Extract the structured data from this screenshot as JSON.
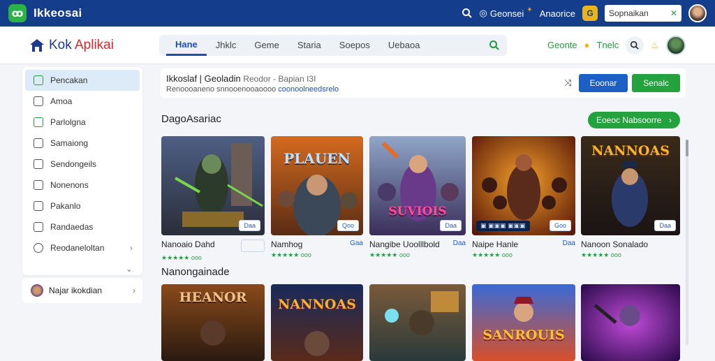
{
  "topbar": {
    "brand": "Ikkeosai",
    "link1": "Geonsei",
    "link2": "Anaorice",
    "gold_label": "G",
    "search_value": "Sopnaikan"
  },
  "navbar": {
    "title_a": "Kok ",
    "title_b": "Aplikai",
    "tabs": [
      "Hane",
      "Jhklc",
      "Geme",
      "Staria",
      "Soepos",
      "Uebaoa"
    ],
    "right_link": "Geonte",
    "right_text": "Tnelc"
  },
  "sidebar": {
    "items": [
      {
        "label": "Pencakan"
      },
      {
        "label": "Amoa"
      },
      {
        "label": "Parlolgna"
      },
      {
        "label": "Samaiong"
      },
      {
        "label": "Sendongeils"
      },
      {
        "label": "Nonenons"
      },
      {
        "label": "Pakanlo"
      },
      {
        "label": "Randaedas"
      },
      {
        "label": "Reodaneloltan"
      }
    ],
    "footer_label": "Najar ikokdian"
  },
  "toolbar": {
    "line1": "Ikkoslaf | Geoladin",
    "line1b": "Reodor - Bapian I3I",
    "line2": "Renoooaneno snnooenooaoooo",
    "line2b": "coonoolneedsrelo",
    "primary": "Eoonar",
    "secondary": "Senalc"
  },
  "section1": {
    "title": "DagoAsariac",
    "see_all": "Eoeoc Nabsoorre"
  },
  "section2": {
    "title": "Nanongainade"
  },
  "cards": [
    {
      "name": "Nanoaio Dahd",
      "tag": "",
      "badge": "Daa",
      "stars": "★★★★★ ooo",
      "cover": ""
    },
    {
      "name": "Namhog",
      "tag": "Gaa",
      "badge": "Qoo",
      "stars": "★★★★★ ooo",
      "cover": "PLAUEN"
    },
    {
      "name": "Nangibe Uoolllbold",
      "tag": "Daa",
      "badge": "Daa",
      "stars": "★★★★★ ooo",
      "cover": "SUVIOIS"
    },
    {
      "name": "Naipe Hanle",
      "tag": "Daa",
      "badge": "Goo",
      "stars": "★★★★★ ooo",
      "cover": ""
    },
    {
      "name": "Nanoon Sonalado",
      "tag": "",
      "badge": "Daa",
      "stars": "★★★★★ ooo",
      "cover": "NANNOAS"
    }
  ],
  "covers2": [
    "HEANOR",
    "NANNOAS",
    "",
    "",
    "SANROUIS"
  ],
  "colors": {
    "brand_blue": "#143d8c",
    "accent_green": "#24a23e",
    "primary_blue": "#1d5fc4"
  }
}
